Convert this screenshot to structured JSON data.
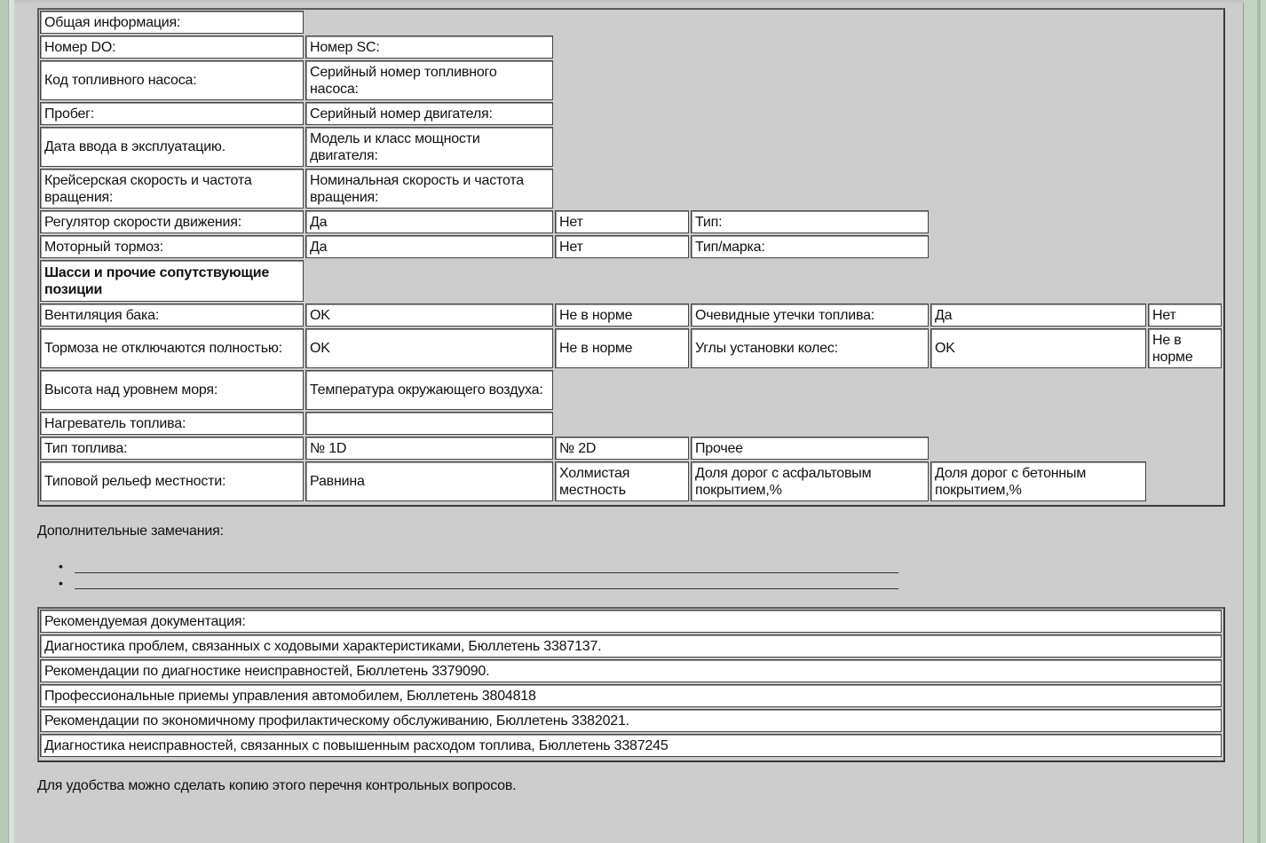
{
  "general": {
    "header": "Общая информация:",
    "do_number": "Номер DO:",
    "sc_number": "Номер SC:",
    "fuel_pump_code": "Код топливного насоса:",
    "fuel_pump_serial": "Серийный номер топливного насоса:",
    "mileage": "Пробег:",
    "engine_serial": "Серийный номер двигателя:",
    "commission_date": "Дата ввода в эксплуатацию.",
    "engine_model": "Модель и класс мощности двигателя:",
    "cruise_speed": "Крейсерская скорость и частота вращения:",
    "nominal_speed": "Номинальная скорость и частота вращения:",
    "speed_regulator": "Регулятор скорости движения:",
    "speed_regulator_yes": "Да",
    "speed_regulator_no": "Нет",
    "speed_regulator_type": "Тип:",
    "engine_brake": "Моторный тормоз:",
    "engine_brake_yes": "Да",
    "engine_brake_no": "Нет",
    "engine_brake_type": "Тип/марка:"
  },
  "chassis": {
    "header": "Шасси и прочие сопутствующие позиции",
    "tank_vent": "Вентиляция бака:",
    "tank_vent_ok": "OK",
    "tank_vent_bad": "Не в норме",
    "fuel_leaks": "Очевидные утечки топлива:",
    "fuel_leaks_yes": "Да",
    "fuel_leaks_no": "Нет",
    "brakes": "Тормоза не отключаются полностью:",
    "brakes_ok": "OK",
    "brakes_bad": "Не в норме",
    "wheel_alignment": "Углы установки колес:",
    "wheel_alignment_ok": "OK",
    "wheel_alignment_bad": "Не в норме",
    "altitude": "Высота над уровнем моря:",
    "ambient_temp": "Температура окружающего воздуха:",
    "fuel_heater": "Нагреватель топлива:",
    "fuel_type": "Тип топлива:",
    "fuel_1d": "№ 1D",
    "fuel_2d": "№ 2D",
    "fuel_other": "Прочее",
    "terrain": "Типовой рельеф местности:",
    "terrain_flat": "Равнина",
    "terrain_hilly": "Холмистая местность",
    "asphalt_share": "Доля дорог с асфальтовым покрытием,%",
    "concrete_share": "Доля дорог с бетонным покрытием,%"
  },
  "notes": {
    "label": "Дополнительные замечания:",
    "bullet": "•"
  },
  "docs": {
    "header": "Рекомендуемая документация:",
    "items": [
      "Диагностика проблем, связанных с ходовыми характеристиками, Бюллетень 3387137.",
      "Рекомендации по диагностике неисправностей, Бюллетень 3379090.",
      "Профессиональные приемы управления автомобилем, Бюллетень 3804818",
      "Рекомендации по экономичному профилактическому обслуживанию, Бюллетень 3382021.",
      "Диагностика неисправностей, связанных с повышенным расходом топлива, Бюллетень 3387245"
    ]
  },
  "footer": {
    "copy_note": "Для удобства можно сделать копию этого перечня контрольных вопросов."
  }
}
